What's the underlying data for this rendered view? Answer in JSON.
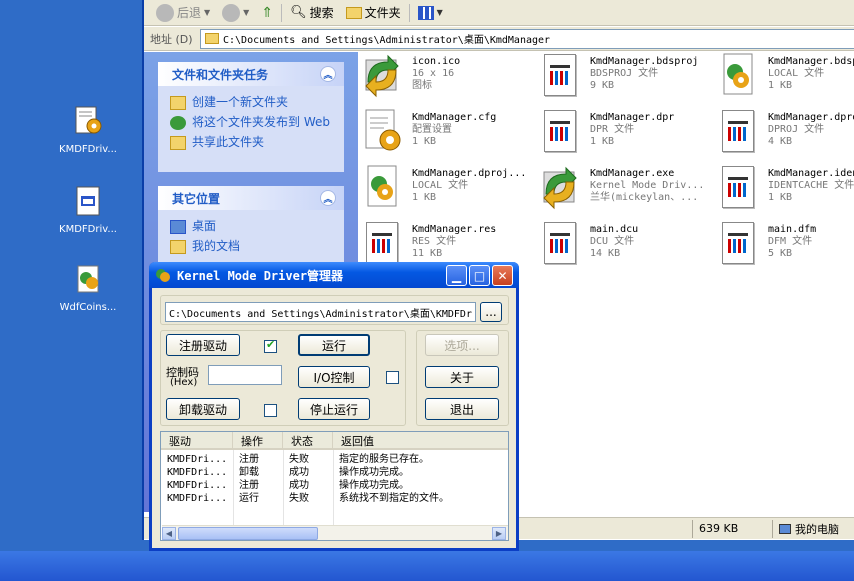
{
  "desktop": {
    "icons": [
      {
        "label": "KMDFDriv...",
        "icon": "config-gear-icon"
      },
      {
        "label": "KMDFDriv...",
        "icon": "application-window-icon"
      },
      {
        "label": "WdfCoins...",
        "icon": "gear-puzzle-icon"
      }
    ]
  },
  "explorer": {
    "toolbar": {
      "back": "后退",
      "search": "搜索",
      "folders": "文件夹"
    },
    "address": {
      "label": "地址 (D)",
      "path": "C:\\Documents and Settings\\Administrator\\桌面\\KmdManager"
    },
    "tasks": {
      "title": "文件和文件夹任务",
      "items": [
        "创建一个新文件夹",
        "将这个文件夹发布到 Web",
        "共享此文件夹"
      ]
    },
    "other_places": {
      "title": "其它位置",
      "items": [
        "桌面",
        "我的文档"
      ]
    },
    "files": [
      {
        "name": "icon.ico",
        "type": "16 x 16",
        "size": "图标",
        "icon": "arrows-refresh-icon"
      },
      {
        "name": "KmdManager.bdsproj",
        "type": "BDSPROJ 文件",
        "size": "9 KB",
        "icon": "document-icon"
      },
      {
        "name": "KmdManager.bdsproj.local",
        "type": "LOCAL 文件",
        "size": "1 KB",
        "icon": "gear-document-icon"
      },
      {
        "name": "KmdManager.cfg",
        "type": "配置设置",
        "size": "1 KB",
        "icon": "config-file-icon"
      },
      {
        "name": "KmdManager.dpr",
        "type": "DPR 文件",
        "size": "1 KB",
        "icon": "document-icon"
      },
      {
        "name": "KmdManager.dproj",
        "type": "DPROJ 文件",
        "size": "4 KB",
        "icon": "document-icon"
      },
      {
        "name": "KmdManager.dproj...",
        "type": "LOCAL 文件",
        "size": "1 KB",
        "icon": "gear-document-icon"
      },
      {
        "name": "KmdManager.exe",
        "type": "Kernel Mode Driv...",
        "size": "兰华(mickeylan、...",
        "icon": "arrows-refresh-icon"
      },
      {
        "name": "KmdManager.identcache",
        "type": "IDENTCACHE 文件",
        "size": "1 KB",
        "icon": "document-icon"
      },
      {
        "name": "KmdManager.res",
        "type": "RES 文件",
        "size": "11 KB",
        "icon": "document-icon"
      },
      {
        "name": "main.dcu",
        "type": "DCU 文件",
        "size": "14 KB",
        "icon": "document-icon"
      },
      {
        "name": "main.dfm",
        "type": "DFM 文件",
        "size": "5 KB",
        "icon": "document-icon"
      }
    ],
    "status": {
      "size": "639 KB",
      "location": "我的电脑"
    }
  },
  "dialog": {
    "title": "Kernel Mode Driver管理器",
    "path": "C:\\Documents and Settings\\Administrator\\桌面\\KMDFDr",
    "browse": "...",
    "register": "注册驱动",
    "run": "运行",
    "control_code_label": "控制码",
    "hex_label": "(Hex)",
    "io_control": "I/O控制",
    "unload": "卸载驱动",
    "stop": "停止运行",
    "options": "选项...",
    "about": "关于",
    "exit": "退出",
    "register_checked": true,
    "io_checked": false,
    "unload_checked": false,
    "log": {
      "columns": [
        "驱动",
        "操作",
        "状态",
        "返回值"
      ],
      "rows": [
        [
          "KMDFDri...",
          "注册",
          "失败",
          "指定的服务已存在。"
        ],
        [
          "KMDFDri...",
          "卸载",
          "成功",
          "操作成功完成。"
        ],
        [
          "KMDFDri...",
          "注册",
          "成功",
          "操作成功完成。"
        ],
        [
          "KMDFDri...",
          "运行",
          "失败",
          "系统找不到指定的文件。"
        ]
      ]
    }
  }
}
